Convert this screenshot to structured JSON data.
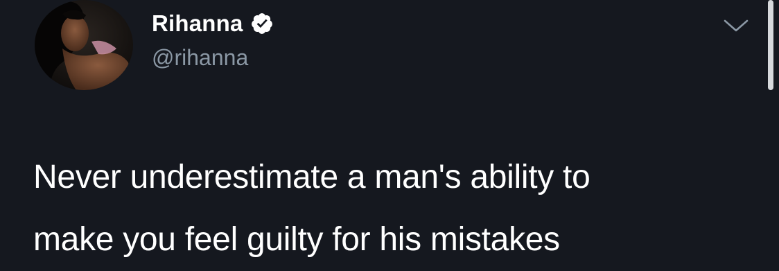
{
  "tweet": {
    "author": {
      "display_name": "Rihanna",
      "handle": "@rihanna",
      "verified": true
    },
    "text": "Never underestimate a man's ability to\nmake you feel guilty for his mistakes"
  },
  "icons": {
    "verified": "verified-check-icon",
    "menu": "chevron-down-icon"
  },
  "colors": {
    "background": "#15181f",
    "text": "#ffffff",
    "handle": "#8b98a5",
    "badge": "#ffffff"
  }
}
